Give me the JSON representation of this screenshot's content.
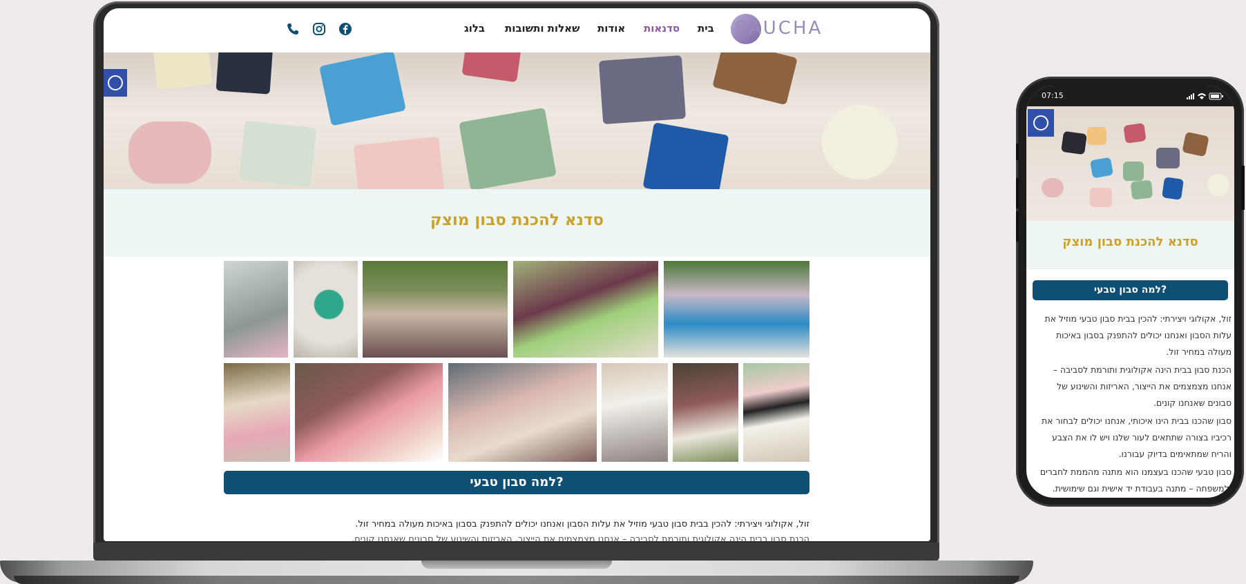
{
  "site": {
    "logo_text": "SAUCHA",
    "nav": [
      "בית",
      "סדנאות",
      "אודות",
      "שאלות ותשובות",
      "בלוג"
    ],
    "active_nav": "סדנאות",
    "social_icons": [
      "facebook-icon",
      "instagram-icon",
      "phone-icon"
    ],
    "page_title": "סדנא להכנת סבון מוצק",
    "why_button": "למה סבון טבעי?",
    "paragraph_1": "זול, אקולוגי ויצירתי: להכין בבית סבון טבעי מוזיל את עלות הסבון ואנחנו יכולים להתפנק בסבון באיכות מעולה במחיר זול.",
    "paragraph_2": "הכנת סבון בבית הינה אקולוגית ותורמת לסביבה – אנחנו מצמצמים את הייצור, האריזות והשינוע של סבונים שאנחנו קונים."
  },
  "phone": {
    "time": "07:15",
    "lines": [
      "זול, אקולוגי ויצירתי: להכין בבית סבון טבעי מוזיל את",
      "עלות הסבון ואנחנו יכולים להתפנק בסבון באיכות",
      "מעולה במחיר זול.",
      "הכנת סבון בבית הינה אקולוגית ותורמת לסביבה –",
      "אנחנו מצמצמים את הייצור, האריזות והשינוע של",
      "סבונים שאנחנו קונים.",
      "סבון שהכנו בבית הינו איכותי, אנחנו יכולים לבחור את",
      "רכיביו בצורה שתתאים לעור שלנו ויש לו את הצבע",
      "והריח שמתאימים בדיוק עבורנו.",
      "סבון טבעי שהכנו בעצמנו הוא מתנה מהממת לחברים",
      "ולמשפחה – מתנה בעבודת יד אישית וגם שימושית."
    ]
  },
  "colors": {
    "accent_gold": "#caa12a",
    "nav_active": "#8e5aa0",
    "button_navy": "#0f4f73",
    "accessibility_blue": "#3150a8"
  }
}
